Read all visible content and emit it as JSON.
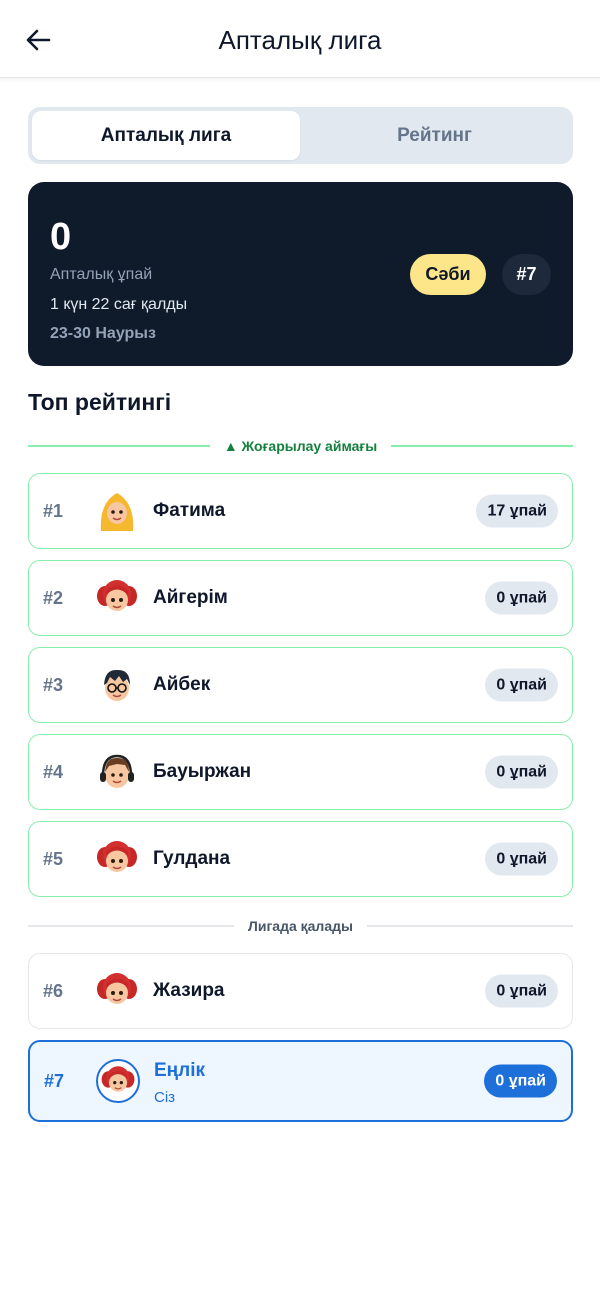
{
  "header": {
    "title": "Апталық лига",
    "back_icon": "arrow-left-icon"
  },
  "tabs": [
    {
      "label": "Апталық лига",
      "active": true
    },
    {
      "label": "Рейтинг",
      "active": false
    }
  ],
  "stats": {
    "points": "0",
    "points_label": "Апталық ұпай",
    "time_left": "1 күн 22 сағ қалды",
    "dates": "23-30 Наурыз",
    "league": "Сәби",
    "rank": "#7",
    "colors": {
      "card": "#0f1a2b",
      "league_badge": "#fde68a"
    }
  },
  "section_title": "Топ рейтингі",
  "promotion_zone_label": "▲ Жоғарылау аймағы",
  "stay_zone_label": "Лигада қалады",
  "leaderboard": [
    {
      "rank": "#1",
      "name": "Фатима",
      "points": "17 ұпай",
      "avatar": "girl-hijab-avatar"
    },
    {
      "rank": "#2",
      "name": "Айгерім",
      "points": "0 ұпай",
      "avatar": "girl-red-hair-avatar"
    },
    {
      "rank": "#3",
      "name": "Айбек",
      "points": "0 ұпай",
      "avatar": "boy-glasses-avatar"
    },
    {
      "rank": "#4",
      "name": "Бауыржан",
      "points": "0 ұпай",
      "avatar": "boy-headphones-avatar"
    },
    {
      "rank": "#5",
      "name": "Гулдана",
      "points": "0 ұпай",
      "avatar": "girl-red-hair-avatar"
    },
    {
      "rank": "#6",
      "name": "Жазира",
      "points": "0 ұпай",
      "avatar": "girl-red-hair-avatar"
    },
    {
      "rank": "#7",
      "name": "Еңлік",
      "sub": "Сіз",
      "points": "0 ұпай",
      "avatar": "girl-red-hair-avatar"
    }
  ],
  "colors": {
    "accent": "#1d6fd9",
    "promotion": "#15803d",
    "promotion_border": "#86efac"
  }
}
